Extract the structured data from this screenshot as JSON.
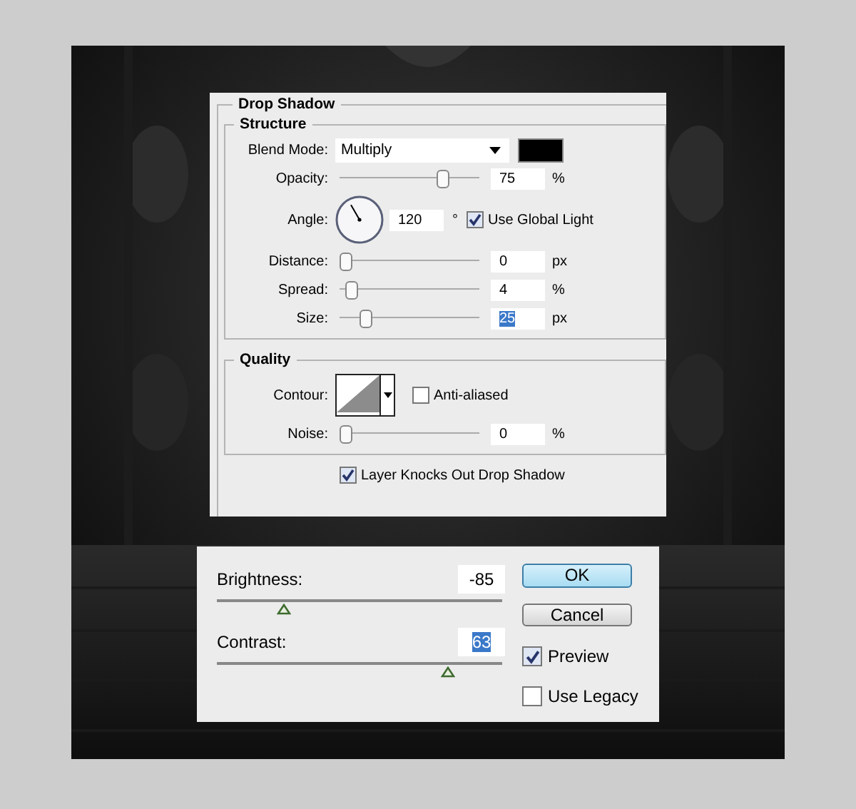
{
  "drop_shadow": {
    "title": "Drop Shadow",
    "structure": {
      "title": "Structure",
      "rows": [
        {
          "kind": "blend",
          "label": "Blend Mode:",
          "value": "Multiply",
          "color": "#000000"
        },
        {
          "kind": "slider",
          "label": "Opacity:",
          "level": 0.75,
          "value": "75",
          "unit": "%",
          "highlighted": false
        },
        {
          "kind": "angle",
          "label": "Angle:",
          "value": "120",
          "unit": "°",
          "checkbox": {
            "label": "Use Global Light",
            "checked": true
          }
        },
        {
          "kind": "slider",
          "label": "Distance:",
          "level": 0,
          "value": "0",
          "unit": "px",
          "highlighted": false
        },
        {
          "kind": "slider",
          "label": "Spread:",
          "level": 0.04,
          "value": "4",
          "unit": "%",
          "highlighted": false
        },
        {
          "kind": "slider",
          "label": "Size:",
          "level": 0.15,
          "value": "25",
          "unit": "px",
          "highlighted": true
        }
      ]
    },
    "quality": {
      "title": "Quality",
      "rows": [
        {
          "kind": "contour",
          "label": "Contour:",
          "checkbox": {
            "label": "Anti-aliased",
            "checked": false
          }
        },
        {
          "kind": "slider",
          "label": "Noise:",
          "level": 0,
          "value": "0",
          "unit": "%",
          "highlighted": false
        }
      ]
    },
    "knockout": {
      "label": "Layer Knocks Out Drop Shadow",
      "checked": true
    }
  },
  "brightness_contrast": {
    "sliders": [
      {
        "label": "Brightness:",
        "value": "-85",
        "level": 0.22,
        "highlighted": false
      },
      {
        "label": "Contrast:",
        "value": "63",
        "level": 0.82,
        "highlighted": true
      }
    ],
    "buttons": [
      {
        "label": "OK",
        "default": true
      },
      {
        "label": "Cancel",
        "default": false
      }
    ],
    "checkboxes": [
      {
        "label": "Preview",
        "checked": true
      },
      {
        "label": "Use Legacy",
        "checked": false
      }
    ]
  }
}
